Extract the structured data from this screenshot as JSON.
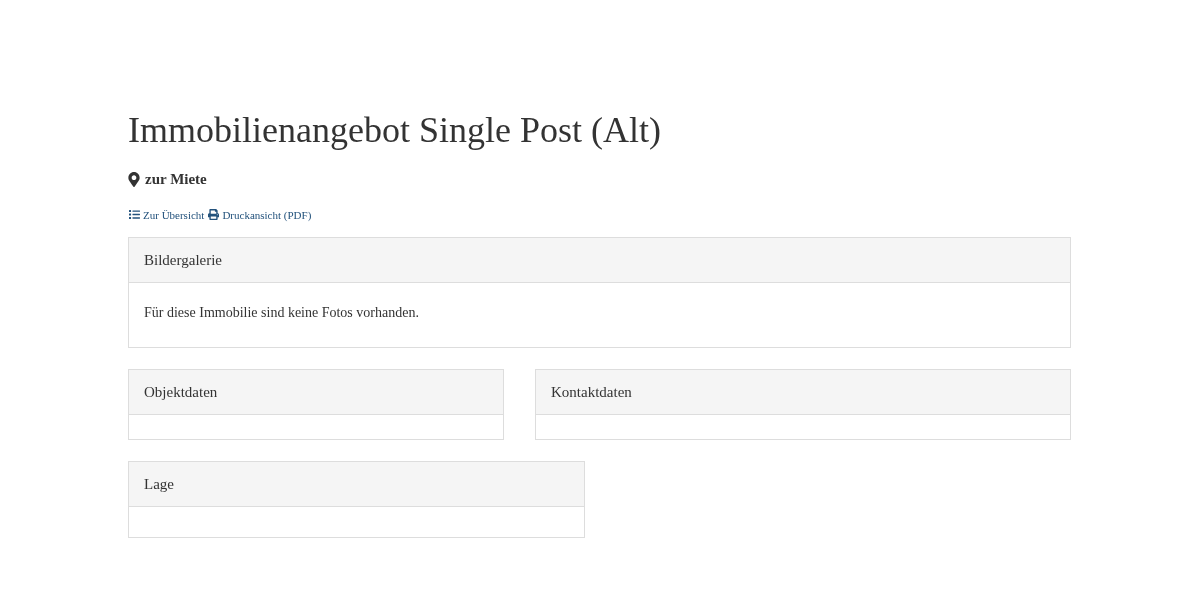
{
  "title": "Immobilienangebot Single Post (Alt)",
  "subtitle": "zur Miete",
  "links": [
    {
      "kind": "list",
      "label": "Zur Übersicht"
    },
    {
      "kind": "print",
      "label": "Druckansicht (PDF)"
    }
  ],
  "gallery": {
    "heading": "Bildergalerie",
    "text": "Für diese Immobilie sind keine Fotos vorhanden."
  },
  "panels": [
    {
      "heading": "Objektdaten"
    },
    {
      "heading": "Kontaktdaten"
    }
  ],
  "location": {
    "heading": "Lage"
  }
}
